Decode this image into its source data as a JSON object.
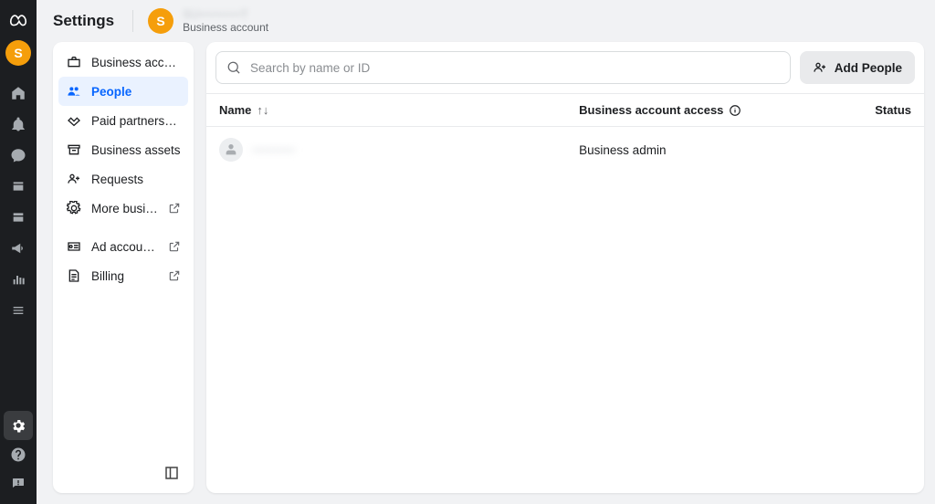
{
  "header": {
    "title": "Settings",
    "account_initial": "S",
    "account_name": "SU••••••••••T",
    "account_type": "Business account"
  },
  "rail": {
    "avatar_initial": "S"
  },
  "sidebar": {
    "items": [
      {
        "label": "Business accou...",
        "icon": "briefcase-icon",
        "external": false
      },
      {
        "label": "People",
        "icon": "people-icon",
        "external": false,
        "active": true
      },
      {
        "label": "Paid partnerships",
        "icon": "handshake-icon",
        "external": false
      },
      {
        "label": "Business assets",
        "icon": "archive-icon",
        "external": false
      },
      {
        "label": "Requests",
        "icon": "user-plus-icon",
        "external": false
      },
      {
        "label": "More busines...",
        "icon": "gear-icon",
        "external": true
      },
      {
        "label": "Ad account s...",
        "icon": "id-card-icon",
        "external": true
      },
      {
        "label": "Billing",
        "icon": "invoice-icon",
        "external": true
      }
    ]
  },
  "toolbar": {
    "search_placeholder": "Search by name or ID",
    "search_value": "",
    "add_people_label": "Add People"
  },
  "table": {
    "columns": {
      "name": "Name",
      "access": "Business account access",
      "status": "Status"
    },
    "rows": [
      {
        "name": "••••••••••",
        "access": "Business admin",
        "status": ""
      }
    ]
  }
}
